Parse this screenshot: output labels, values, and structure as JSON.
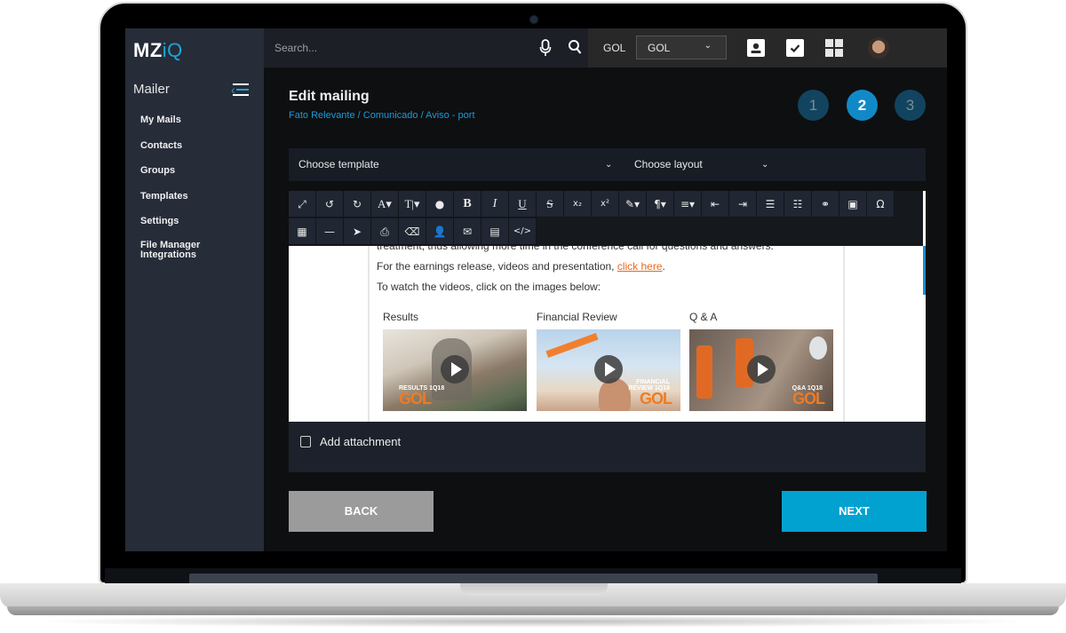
{
  "app": {
    "logo_main": "MZ",
    "logo_accent": "iQ",
    "module": "Mailer"
  },
  "sidebar": {
    "items": [
      {
        "label": "My Mails"
      },
      {
        "label": "Contacts"
      },
      {
        "label": "Groups"
      },
      {
        "label": "Templates"
      },
      {
        "label": "Settings"
      },
      {
        "label": "File Manager\nIntegrations"
      }
    ]
  },
  "topbar": {
    "search_placeholder": "Search...",
    "company_label": "GOL",
    "company_selected": "GOL",
    "icons": [
      "mic-icon",
      "search-icon",
      "contact-card-icon",
      "checkbox-icon",
      "apps-grid-icon",
      "user-avatar"
    ]
  },
  "page": {
    "title": "Edit mailing",
    "breadcrumb": "Fato Relevante / Comunicado / Aviso - port",
    "steps": [
      {
        "label": "1",
        "state": "inactive"
      },
      {
        "label": "2",
        "state": "active"
      },
      {
        "label": "3",
        "state": "inactive"
      }
    ]
  },
  "selects": {
    "template": "Choose template",
    "layout": "Choose layout"
  },
  "toolbar": {
    "row1": [
      {
        "name": "fullscreen",
        "glyph": "⤢"
      },
      {
        "name": "undo",
        "glyph": "↺"
      },
      {
        "name": "redo",
        "glyph": "↻"
      },
      {
        "name": "font-family",
        "glyph": "A▾"
      },
      {
        "name": "font-size",
        "glyph": "T|▾"
      },
      {
        "name": "color",
        "glyph": "●"
      },
      {
        "name": "bold",
        "glyph": "B"
      },
      {
        "name": "italic",
        "glyph": "I"
      },
      {
        "name": "underline",
        "glyph": "U"
      },
      {
        "name": "strikethrough",
        "glyph": "S"
      },
      {
        "name": "subscript",
        "glyph": "x₂"
      },
      {
        "name": "superscript",
        "glyph": "x²"
      },
      {
        "name": "magic",
        "glyph": "✎▾"
      },
      {
        "name": "paragraph",
        "glyph": "¶▾"
      },
      {
        "name": "align",
        "glyph": "≡▾"
      },
      {
        "name": "outdent",
        "glyph": "⇤"
      },
      {
        "name": "indent",
        "glyph": "⇥"
      },
      {
        "name": "ordered-list",
        "glyph": "☰"
      },
      {
        "name": "unordered-list",
        "glyph": "☷"
      },
      {
        "name": "link",
        "glyph": "⚭"
      },
      {
        "name": "image",
        "glyph": "▣"
      },
      {
        "name": "special-char",
        "glyph": "Ω"
      }
    ],
    "row2": [
      {
        "name": "table",
        "glyph": "▦"
      },
      {
        "name": "horizontal-rule",
        "glyph": "—"
      },
      {
        "name": "select",
        "glyph": "➤"
      },
      {
        "name": "print",
        "glyph": "⎙"
      },
      {
        "name": "clear-format",
        "glyph": "⌫"
      },
      {
        "name": "add-user",
        "glyph": "👤"
      },
      {
        "name": "email",
        "glyph": "✉"
      },
      {
        "name": "document",
        "glyph": "▤"
      },
      {
        "name": "code-view",
        "glyph": "</>"
      }
    ]
  },
  "content": {
    "line1": "treatment, thus allowing more time in the conference call for questions and answers.",
    "line2_prefix": "For the earnings release, videos and presentation, ",
    "line2_link": "click here",
    "line2_suffix": ".",
    "line3": "To watch the videos, click on the images below:",
    "videos": [
      {
        "title": "Results",
        "caption": "RESULTS 1Q18",
        "brand": "GOL"
      },
      {
        "title": "Financial Review",
        "caption": "FINANCIAL REVIEW 1Q18",
        "brand": "GOL"
      },
      {
        "title": "Q & A",
        "caption": "Q&A 1Q18",
        "brand": "GOL"
      }
    ]
  },
  "attachment": {
    "label": "Add attachment",
    "checked": false
  },
  "actions": {
    "back": "BACK",
    "next": "NEXT"
  },
  "colors": {
    "accent": "#1ba6d8",
    "next_button": "#02a2d0",
    "back_button": "#9b9b9b",
    "link": "#e56a1f",
    "step_active": "#1289c7",
    "step_inactive": "#12445f"
  }
}
